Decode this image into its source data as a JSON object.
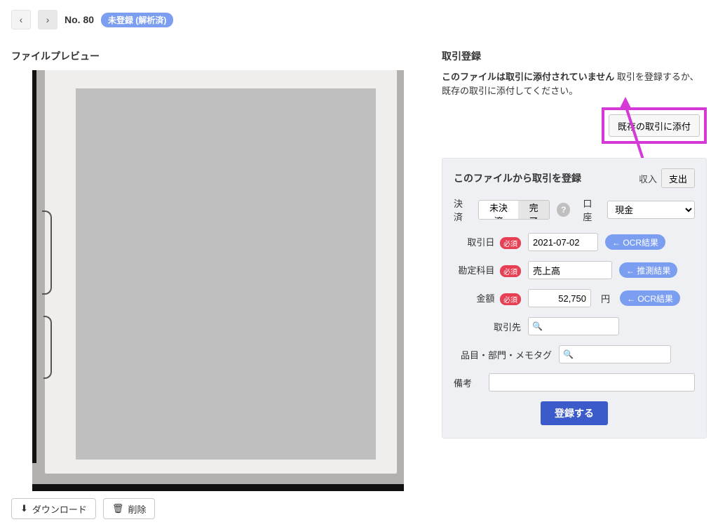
{
  "header": {
    "page_number_label": "No. 80",
    "status_badge": "未登録 (解析済)"
  },
  "preview": {
    "title": "ファイルプレビュー",
    "download_label": "ダウンロード",
    "delete_label": "削除"
  },
  "register": {
    "title": "取引登録",
    "notice_strong": "このファイルは取引に添付されていません",
    "notice_rest": " 取引を登録するか、既存の取引に添付してください。",
    "attach_existing_label": "既存の取引に添付",
    "panel_title": "このファイルから取引を登録",
    "type_income": "収入",
    "type_expense": "支出",
    "settlement_label": "決済",
    "settlement_unsettled": "未決済",
    "settlement_done": "完了",
    "account_label": "口座",
    "account_value": "現金",
    "date_label": "取引日",
    "date_value": "2021-07-02",
    "date_pill": "← OCR結果",
    "category_label": "勘定科目",
    "category_value": "売上高",
    "category_pill": "← 推測結果",
    "amount_label": "金額",
    "amount_value": "52,750",
    "amount_unit": "円",
    "amount_pill": "← OCR結果",
    "partner_label": "取引先",
    "tags_label": "品目・部門・メモタグ",
    "note_label": "備考",
    "required_badge": "必須",
    "submit_label": "登録する"
  }
}
